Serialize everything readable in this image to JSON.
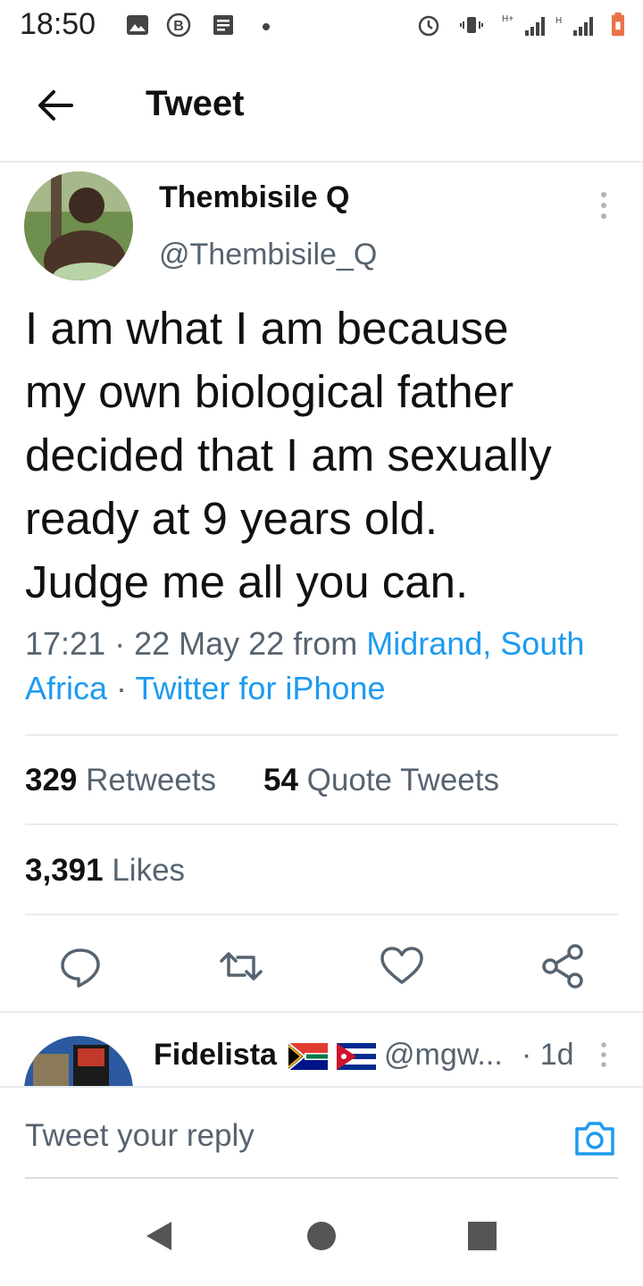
{
  "status_bar": {
    "time": "18:50"
  },
  "header": {
    "title": "Tweet"
  },
  "tweet": {
    "author_name": "Thembisile Q",
    "author_handle": "@Thembisile_Q",
    "text_lines": [
      "I am what I am because",
      "my own biological father",
      "decided that I am sexually",
      "ready at 9 years old.",
      "Judge me all you can."
    ],
    "time": "17:21",
    "dot1": " · ",
    "date": "22 May 22",
    "from": " from ",
    "location": "Midrand, South Africa",
    "dot2": " · ",
    "source": "Twitter for iPhone",
    "retweets_count": "329",
    "retweets_label": "Retweets",
    "quotes_count": "54",
    "quotes_label": "Quote Tweets",
    "likes_count": "3,391",
    "likes_label": "Likes"
  },
  "reply_preview": {
    "name": "Fidelista",
    "handle": "@mgw...",
    "time": "· 1d"
  },
  "composer": {
    "placeholder": "Tweet your reply"
  },
  "colors": {
    "link": "#1d9bf0",
    "muted": "#566370",
    "divider": "#e6ecf0"
  },
  "icons": [
    "back-arrow-icon",
    "more-vertical-icon",
    "reply-icon",
    "retweet-icon",
    "like-icon",
    "share-icon",
    "camera-icon",
    "nav-back-icon",
    "nav-home-icon",
    "nav-recents-icon"
  ]
}
